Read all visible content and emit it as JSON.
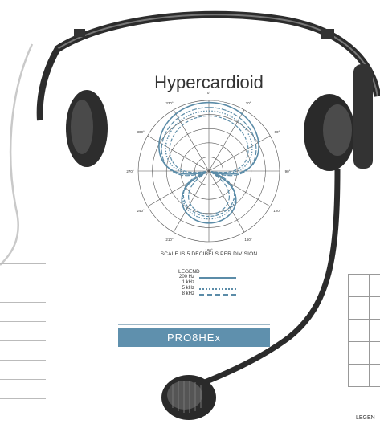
{
  "chart_data": {
    "type": "polar",
    "title": "Hypercardioid",
    "angle_labels": [
      "0°",
      "30°",
      "60°",
      "90°",
      "120°",
      "150°",
      "180°",
      "210°",
      "240°",
      "270°",
      "300°",
      "330°"
    ],
    "scale_note": "SCALE IS 5 DECIBELS PER DIVISION",
    "series": [
      {
        "name": "200 Hz"
      },
      {
        "name": "1 kHz"
      },
      {
        "name": "5 kHz"
      },
      {
        "name": "8 kHz"
      }
    ]
  },
  "legend": {
    "title": "LEGEND",
    "items": [
      "200 Hz",
      "1 kHz",
      "5 kHz",
      "8 kHz"
    ]
  },
  "product": {
    "model": "PRO8HEx"
  },
  "right_legend": "LEGEN",
  "colors": {
    "band": "#5f90ad",
    "plot": "#5b8ca8"
  }
}
